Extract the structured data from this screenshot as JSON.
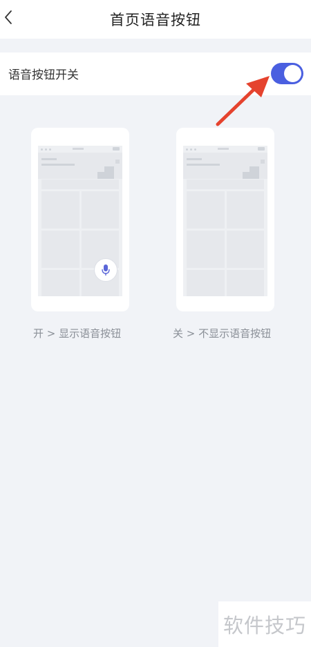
{
  "header": {
    "title": "首页语音按钮",
    "back_icon": "chevron-left-icon"
  },
  "setting": {
    "label": "语音按钮开关",
    "toggle_on": true,
    "toggle_color": "#4a5fe0"
  },
  "annotation": {
    "arrow_color": "#e5432e"
  },
  "previews": [
    {
      "caption": "开 > 显示语音按钮",
      "shows_voice_button": true,
      "voice_icon": "microphone-icon"
    },
    {
      "caption": "关 > 不显示语音按钮",
      "shows_voice_button": false
    }
  ],
  "watermark": "软件技巧"
}
